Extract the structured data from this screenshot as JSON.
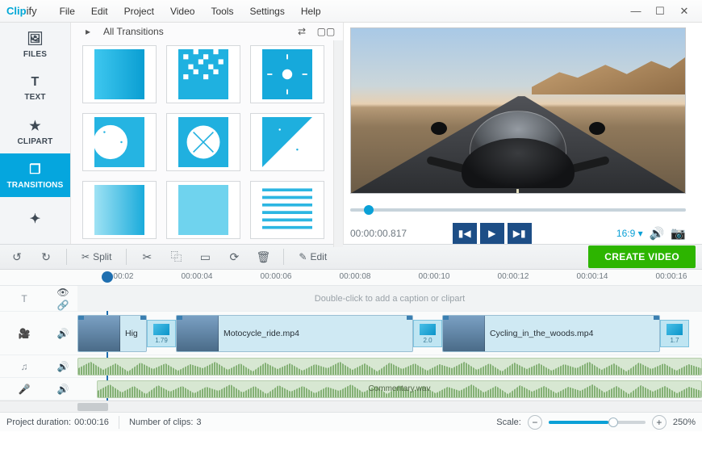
{
  "brand": {
    "part1": "Clip",
    "part2": "ify"
  },
  "menu": {
    "file": "File",
    "edit": "Edit",
    "project": "Project",
    "video": "Video",
    "tools": "Tools",
    "settings": "Settings",
    "help": "Help"
  },
  "sidebar": {
    "files": "FILES",
    "text": "TEXT",
    "clipart": "CLIPART",
    "transitions": "TRANSITIONS"
  },
  "panel": {
    "title": "All Transitions"
  },
  "preview": {
    "timecode": "00:00:00.817",
    "aspect": "16:9"
  },
  "toolbar": {
    "split": "Split",
    "edit": "Edit",
    "create": "CREATE VIDEO"
  },
  "ruler": {
    "t0": "00:00:02",
    "t1": "00:00:04",
    "t2": "00:00:06",
    "t3": "00:00:08",
    "t4": "00:00:10",
    "t5": "00:00:12",
    "t6": "00:00:14",
    "t7": "00:00:16"
  },
  "caption_hint": "Double-click to add a caption or clipart",
  "clips": {
    "c0": {
      "label": "Hig"
    },
    "t0": {
      "dur": "1.79"
    },
    "c1": {
      "label": "Motocycle_ride.mp4"
    },
    "t1": {
      "dur": "2.0"
    },
    "c2": {
      "label": "Cycling_in_the_woods.mp4"
    },
    "t2": {
      "dur": "1.7"
    }
  },
  "audio2": {
    "label": "Commentary.wav"
  },
  "status": {
    "dur_label": "Project duration:",
    "dur_val": "00:00:16",
    "clips_label": "Number of clips:",
    "clips_val": "3",
    "scale_label": "Scale:",
    "zoom": "250%"
  }
}
